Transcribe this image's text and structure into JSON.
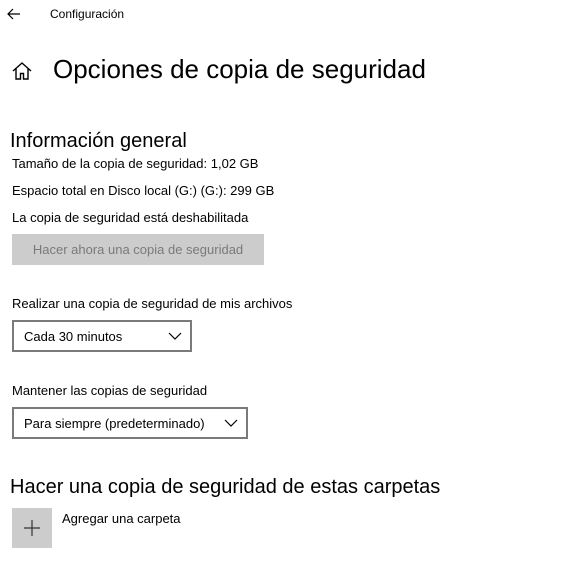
{
  "window": {
    "app_title": "Configuración"
  },
  "header": {
    "page_title": "Opciones de copia de seguridad"
  },
  "overview": {
    "section_title": "Información general",
    "backup_size": "Tamaño de la copia de seguridad: 1,02 GB",
    "total_space": "Espacio total en Disco local (G:) (G:): 299 GB",
    "backup_status": "La copia de seguridad está deshabilitada",
    "backup_now_label": "Hacer ahora una copia de seguridad"
  },
  "frequency": {
    "label": "Realizar una copia de seguridad de mis archivos",
    "selected": "Cada 30 minutos"
  },
  "retention": {
    "label": "Mantener las copias de seguridad",
    "selected": "Para siempre (predeterminado)"
  },
  "folders": {
    "section_title": "Hacer una copia de seguridad de estas carpetas",
    "add_folder_label": "Agregar una carpeta"
  },
  "colors": {
    "disabled_button_bg": "#cccccc",
    "disabled_button_text": "#7a7a7a",
    "select_border": "#7a7a7a"
  },
  "icons": [
    "back-arrow-icon",
    "home-icon",
    "chevron-down-icon",
    "plus-icon"
  ]
}
